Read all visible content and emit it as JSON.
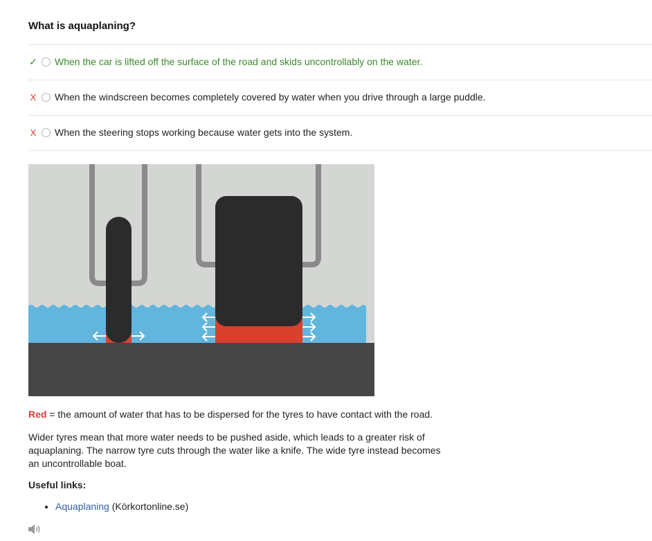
{
  "question": "What is aquaplaning?",
  "options": [
    {
      "text": "When the car is lifted off the surface of the road and skids uncontrollably on the water.",
      "status": "correct",
      "mark": "✓"
    },
    {
      "text": "When the windscreen becomes completely covered by water when you drive through a large puddle.",
      "status": "wrong",
      "mark": "X"
    },
    {
      "text": "When the steering stops working because water gets into the system.",
      "status": "wrong",
      "mark": "X"
    }
  ],
  "illustration": {
    "colors": {
      "background": "#d3d6d3",
      "water": "#62b6dd",
      "road": "#464646",
      "tyre": "#2c2b2c",
      "displaced_water": "#d9402d",
      "suspension": "#8a8a8a"
    }
  },
  "explanation": {
    "caption_red_word": "Red",
    "caption_rest": " = the amount of water that has to be dispersed for the tyres to have contact with the road.",
    "paragraph": "Wider tyres mean that more water needs to be pushed aside, which leads to a greater risk of aquaplaning. The narrow tyre cuts through the water like a knife. The wide tyre instead becomes an uncontrollable boat."
  },
  "useful_links": {
    "title": "Useful links:",
    "items": [
      {
        "label": "Aquaplaning",
        "source": "(Körkortonline.se)"
      }
    ]
  },
  "audio": {
    "icon": "speaker-icon"
  }
}
